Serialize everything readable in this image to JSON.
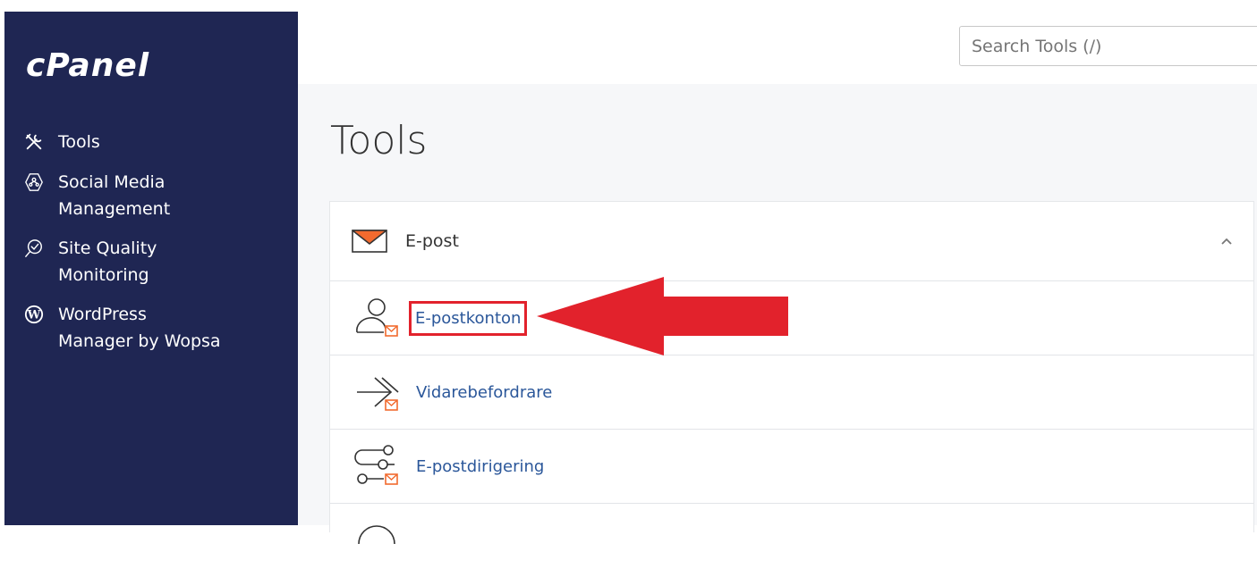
{
  "sidebar": {
    "logo": "cPanel",
    "items": [
      {
        "label_line1": "Tools",
        "label_line2": "",
        "icon": "tools-icon"
      },
      {
        "label_line1": "Social Media",
        "label_line2": "Management",
        "icon": "social-media-icon"
      },
      {
        "label_line1": "Site Quality",
        "label_line2": "Monitoring",
        "icon": "site-quality-icon"
      },
      {
        "label_line1": "WordPress",
        "label_line2": "Manager by Wopsa",
        "icon": "wordpress-icon"
      }
    ]
  },
  "header": {
    "search_placeholder": "Search Tools (/)"
  },
  "main": {
    "title": "Tools",
    "section": {
      "title": "E-post",
      "icon": "envelope-icon",
      "tools": [
        {
          "label": "E-postkonton",
          "icon": "email-accounts-icon",
          "highlighted": true
        },
        {
          "label": "Vidarebefordrare",
          "icon": "forwarders-icon",
          "highlighted": false
        },
        {
          "label": "E-postdirigering",
          "icon": "email-routing-icon",
          "highlighted": false
        }
      ]
    }
  },
  "colors": {
    "sidebar_bg": "#1f2653",
    "link": "#2b579a",
    "accent_orange": "#f26a2e",
    "annotation_red": "#e2222c"
  }
}
